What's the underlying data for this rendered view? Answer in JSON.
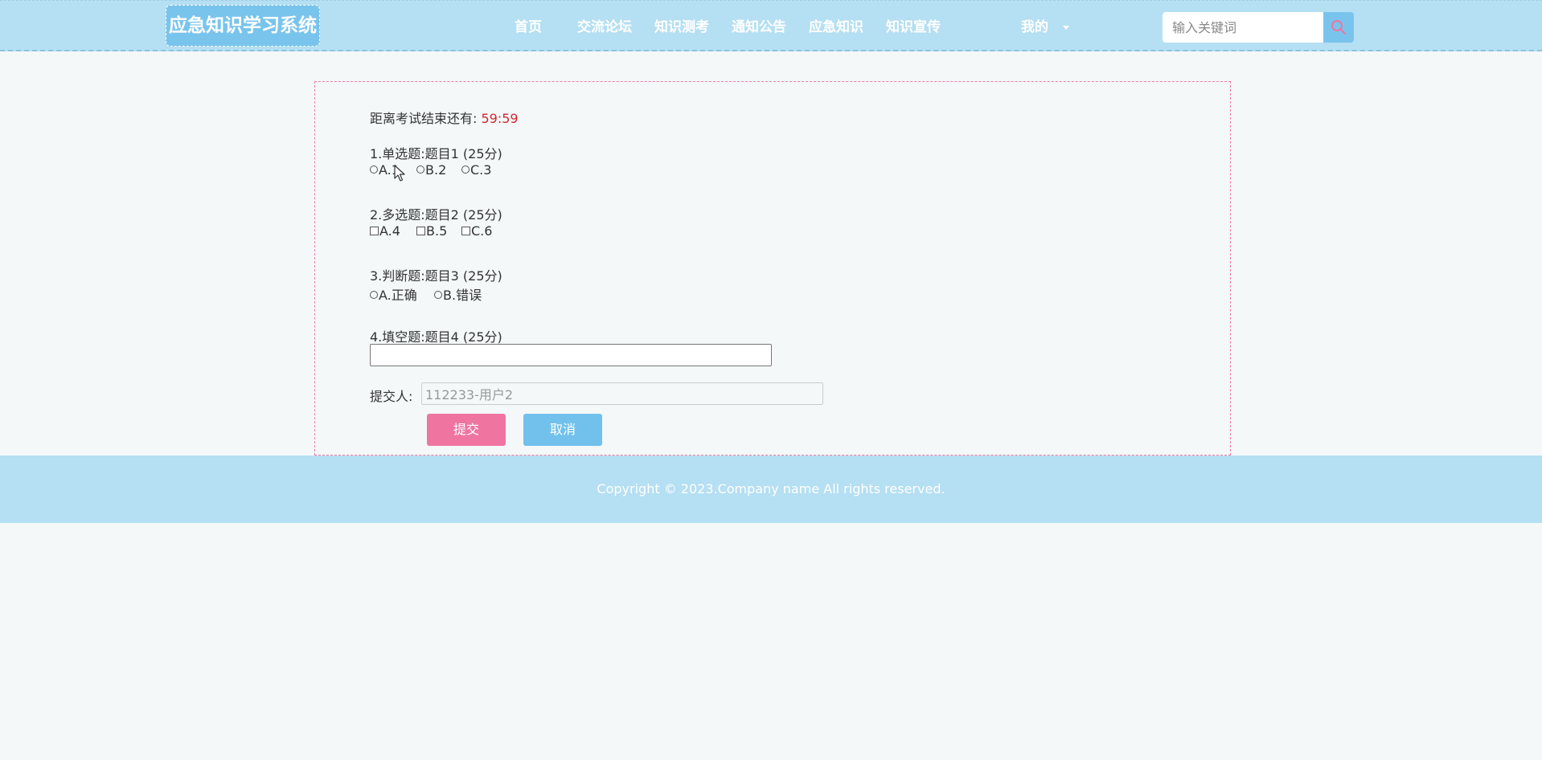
{
  "header": {
    "logo": "应急知识学习系统",
    "nav": [
      {
        "label": "首页"
      },
      {
        "label": "交流论坛"
      },
      {
        "label": "知识测考"
      },
      {
        "label": "通知公告"
      },
      {
        "label": "应急知识"
      },
      {
        "label": "知识宣传"
      },
      {
        "label": "我的"
      }
    ],
    "search": {
      "placeholder": "输入关键词",
      "value": "",
      "icon": "search-icon"
    },
    "colors": {
      "bar": "#b5dff2",
      "accent": "#79c4ec"
    }
  },
  "exam": {
    "countdown_label": "距离考试结束还有:",
    "countdown_value": "59:59",
    "questions": [
      {
        "title": "1.单选题:题目1 (25分)",
        "type": "radio",
        "options": [
          "A.1",
          "B.2",
          "C.3"
        ]
      },
      {
        "title": "2.多选题:题目2 (25分)",
        "type": "checkbox",
        "options": [
          "A.4",
          "B.5",
          "C.6"
        ]
      },
      {
        "title": "3.判断题:题目3 (25分)",
        "type": "radio",
        "options": [
          "A.正确",
          "B.错误"
        ]
      },
      {
        "title": "4.填空题:题目4 (25分)",
        "type": "text",
        "value": ""
      }
    ],
    "submitter_label": "提交人:",
    "submitter_value": "112233-用户2",
    "submit_label": "提交",
    "cancel_label": "取消",
    "colors": {
      "submit": "#ef75a0",
      "cancel": "#72c1ec",
      "countdown": "#d0272f"
    }
  },
  "footer": {
    "copyright": "Copyright © 2023.Company name All rights reserved."
  }
}
